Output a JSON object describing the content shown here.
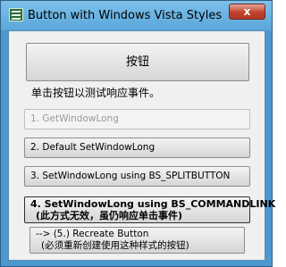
{
  "window": {
    "title": "Button with Windows Vista Styles",
    "close_glyph": "x",
    "icon": "window-app-icon"
  },
  "main": {
    "big_button_label": "按钮",
    "instruction": "单击按钮以测试响应事件。",
    "option_buttons": [
      {
        "label": "1. GetWindowLong",
        "enabled": false
      },
      {
        "label": "2. Default SetWindowLong",
        "enabled": true
      },
      {
        "label": "3. SetWindowLong using BS_SPLITBUTTON",
        "enabled": true
      }
    ],
    "command_link": {
      "line1": "4. SetWindowLong using BS_COMMANDLINK",
      "line2": "(此方式无效，虽仍响应单击事件)"
    },
    "recreate": {
      "line1": "--> (5.) Recreate Button",
      "line2": "(必须重新创建使用这种样式的按钮)"
    }
  },
  "colors": {
    "title_bar": "#6bb4e2",
    "close_button": "#c2412c",
    "client_bg": "#f0f0f0",
    "disabled_text": "#9a9a9a"
  }
}
